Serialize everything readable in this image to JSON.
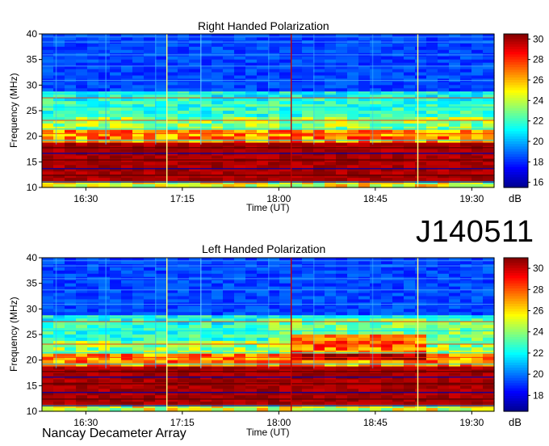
{
  "observation_id": "J140511",
  "credit": "Nancay Decameter Array",
  "colors": {
    "jet": [
      "#00008f",
      "#0000ff",
      "#0080ff",
      "#00ffff",
      "#80ff80",
      "#ffff00",
      "#ff8000",
      "#ff0000",
      "#800000"
    ]
  },
  "chart_data": [
    {
      "type": "heatmap",
      "title": "Right Handed Polarization",
      "xlabel": "Time (UT)",
      "ylabel": "Frequency (MHz)",
      "xticks": [
        "16:30",
        "17:15",
        "18:00",
        "18:45",
        "19:30"
      ],
      "yticks": [
        10,
        15,
        20,
        25,
        30,
        35,
        40
      ],
      "ylim": [
        10,
        40
      ],
      "colorbar": {
        "label": "dB",
        "ticks": [
          16,
          18,
          20,
          22,
          24,
          26,
          28,
          30
        ],
        "range": [
          15.5,
          30.5
        ]
      }
    },
    {
      "type": "heatmap",
      "title": "Left Handed Polarization",
      "xlabel": "Time (UT)",
      "ylabel": "Frequency (MHz)",
      "xticks": [
        "16:30",
        "17:15",
        "18:00",
        "18:45",
        "19:30"
      ],
      "yticks": [
        10,
        15,
        20,
        25,
        30,
        35,
        40
      ],
      "ylim": [
        10,
        40
      ],
      "colorbar": {
        "label": "dB",
        "ticks": [
          18,
          20,
          22,
          24,
          26,
          28,
          30
        ],
        "range": [
          16.5,
          31
        ]
      }
    }
  ]
}
